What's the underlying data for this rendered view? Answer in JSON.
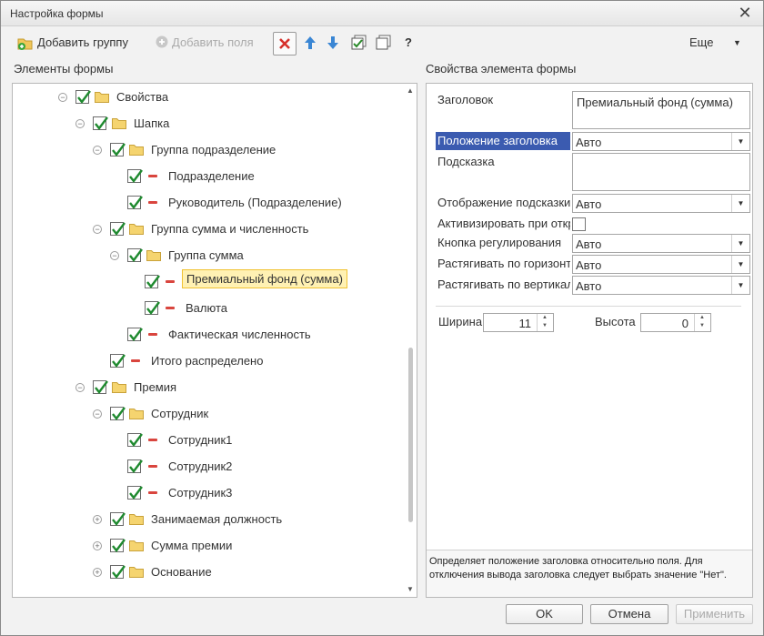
{
  "window": {
    "title": "Настройка формы",
    "close_glyph": "✕"
  },
  "toolbar": {
    "add_group": "Добавить группу",
    "add_field": "Добавить поля",
    "help": "?",
    "more": "Еще",
    "more_arrow": "▼",
    "icons": [
      "add-group-icon",
      "add-field-icon",
      "delete-icon",
      "move-up-icon",
      "move-down-icon",
      "check-all-icon",
      "uncheck-all-icon",
      "help-icon"
    ]
  },
  "left_panel": {
    "label": "Элементы формы"
  },
  "right_panel": {
    "label": "Свойства элемента формы"
  },
  "tree": [
    {
      "label": "Свойства",
      "level": 0,
      "toggle": "⊖",
      "checked": true,
      "kind": "folder"
    },
    {
      "label": "Шапка",
      "level": 1,
      "toggle": "⊖",
      "checked": true,
      "kind": "folder"
    },
    {
      "label": "Группа подразделение",
      "level": 2,
      "toggle": "⊖",
      "checked": true,
      "kind": "folder"
    },
    {
      "label": "Подразделение",
      "level": 3,
      "toggle": "",
      "checked": true,
      "kind": "field"
    },
    {
      "label": "Руководитель (Подразделение)",
      "level": 3,
      "toggle": "",
      "checked": true,
      "kind": "field"
    },
    {
      "label": "Группа сумма и численность",
      "level": 2,
      "toggle": "⊖",
      "checked": true,
      "kind": "folder"
    },
    {
      "label": "Группа сумма",
      "level": 3,
      "toggle": "⊖",
      "checked": true,
      "kind": "folder"
    },
    {
      "label": "Премиальный фонд (сумма)",
      "level": 4,
      "toggle": "",
      "checked": true,
      "kind": "field",
      "selected": true
    },
    {
      "label": "Валюта",
      "level": 4,
      "toggle": "",
      "checked": true,
      "kind": "field"
    },
    {
      "label": "Фактическая численность",
      "level": 3,
      "toggle": "",
      "checked": true,
      "kind": "field"
    },
    {
      "label": "Итого распределено",
      "level": 2,
      "toggle": "",
      "checked": true,
      "kind": "field"
    },
    {
      "label": "Премия",
      "level": 1,
      "toggle": "⊖",
      "checked": true,
      "kind": "folder"
    },
    {
      "label": "Сотрудник",
      "level": 2,
      "toggle": "⊖",
      "checked": true,
      "kind": "folder"
    },
    {
      "label": "Сотрудник1",
      "level": 3,
      "toggle": "",
      "checked": true,
      "kind": "field"
    },
    {
      "label": "Сотрудник2",
      "level": 3,
      "toggle": "",
      "checked": true,
      "kind": "field"
    },
    {
      "label": "Сотрудник3",
      "level": 3,
      "toggle": "",
      "checked": true,
      "kind": "field"
    },
    {
      "label": "Занимаемая должность",
      "level": 2,
      "toggle": "⊕",
      "checked": true,
      "kind": "folder"
    },
    {
      "label": "Сумма премии",
      "level": 2,
      "toggle": "⊕",
      "checked": true,
      "kind": "folder"
    },
    {
      "label": "Основание",
      "level": 2,
      "toggle": "⊕",
      "checked": true,
      "kind": "folder"
    }
  ],
  "props": {
    "header_label": "Заголовок",
    "header_value": "Премиальный фонд (сумма)",
    "title_position_label": "Положение заголовка",
    "title_position_value": "Авто",
    "tooltip_label": "Подсказка",
    "tooltip_value": "",
    "tooltip_display_label": "Отображение подсказки",
    "tooltip_display_value": "Авто",
    "activate_label": "Активизировать при откр",
    "activate_checked": false,
    "adjust_button_label": "Кнопка регулирования",
    "adjust_button_value": "Авто",
    "stretch_h_label": "Растягивать по горизонт",
    "stretch_h_value": "Авто",
    "stretch_v_label": "Растягивать по вертикал",
    "stretch_v_value": "Авто",
    "width_label": "Ширина",
    "width_value": "11",
    "height_label": "Высота",
    "height_value": "0",
    "hint_text": "Определяет положение заголовка относительно поля. Для отключения вывода заголовка следует выбрать значение \"Нет\"."
  },
  "buttons": {
    "ok": "OK",
    "cancel": "Отмена",
    "apply": "Применить"
  }
}
